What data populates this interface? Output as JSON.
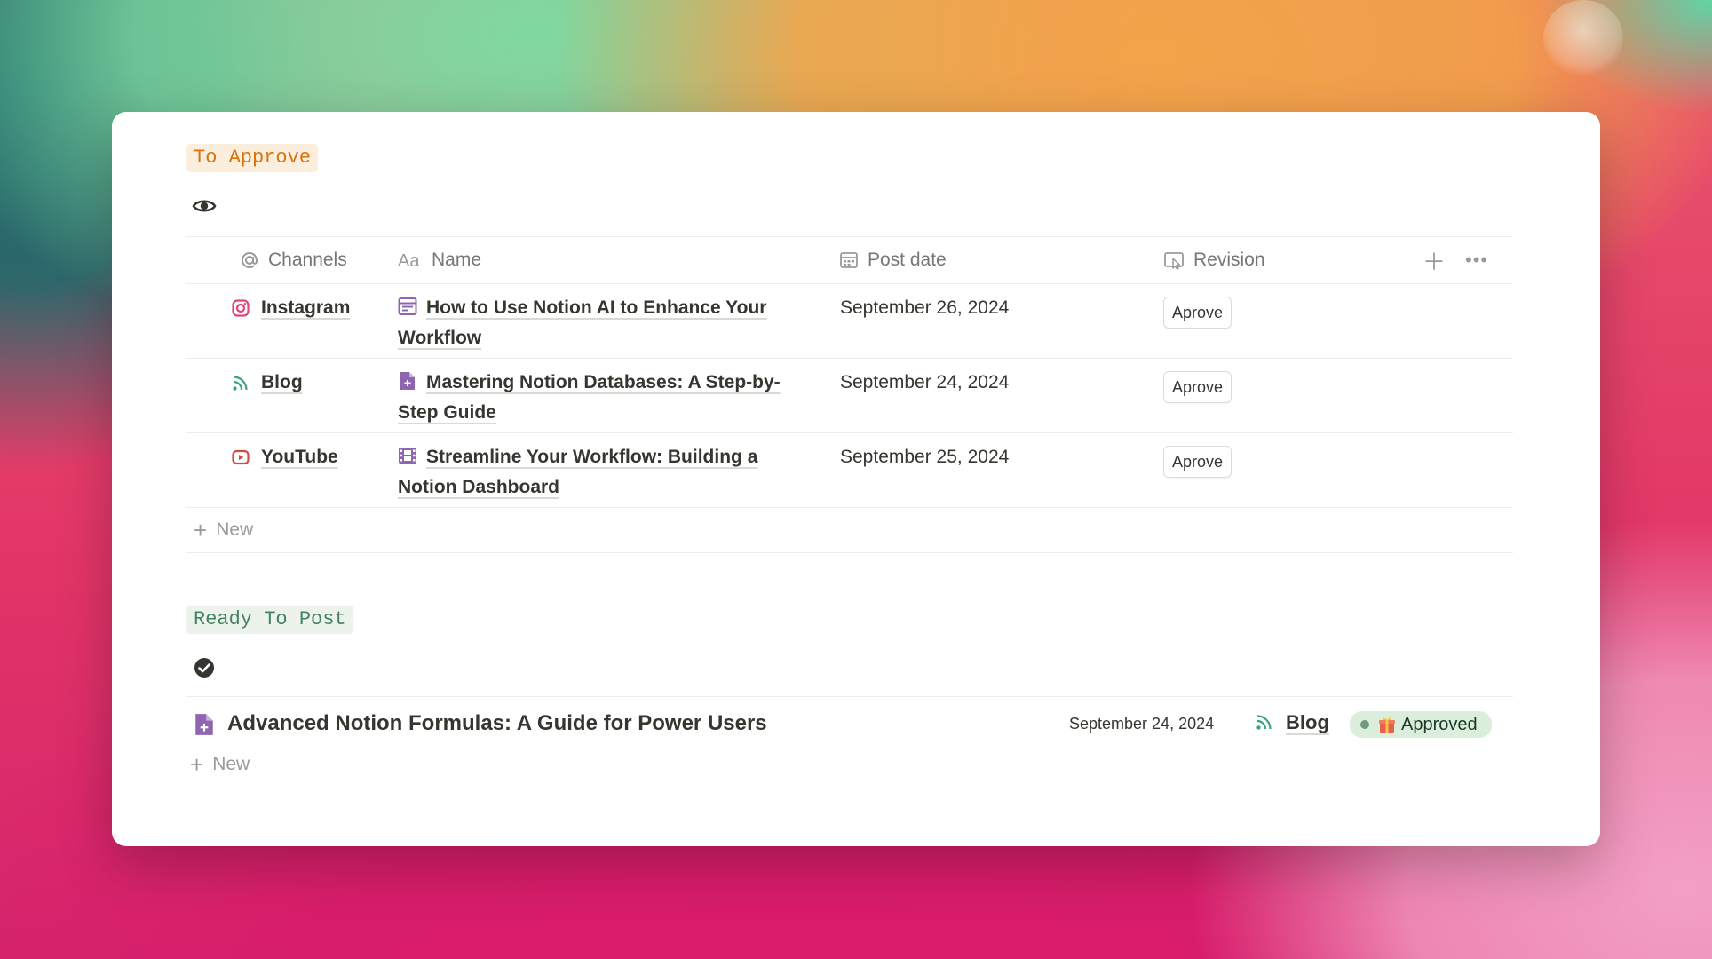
{
  "colors": {
    "to_approve_tag_bg": "#fbeedd",
    "to_approve_tag_text": "#d9730d",
    "ready_tag_bg": "#edf3ec",
    "ready_tag_text": "#448361",
    "approved_badge_bg": "#dbeddb",
    "instagram": "#e0457b",
    "blog": "#3aa57a",
    "youtube": "#d44c47",
    "page_icon": "#9065b0"
  },
  "to_approve": {
    "tag": "To Approve",
    "icon": "eye-icon",
    "columns": {
      "channels": "Channels",
      "name": "Name",
      "post_date": "Post date",
      "revision": "Revision"
    },
    "rows": [
      {
        "channel": "Instagram",
        "channel_icon": "instagram-icon",
        "name_icon": "calendar-layout-icon",
        "name": "How to Use Notion AI to Enhance Your Workflow",
        "post_date": "September 26, 2024",
        "revision_label": "Aprove"
      },
      {
        "channel": "Blog",
        "channel_icon": "rss-icon",
        "name_icon": "document-plus-icon",
        "name": "Mastering Notion Databases: A Step-by-Step Guide",
        "post_date": "September 24, 2024",
        "revision_label": "Aprove"
      },
      {
        "channel": "YouTube",
        "channel_icon": "youtube-icon",
        "name_icon": "film-icon",
        "name": "Streamline Your Workflow: Building a Notion Dashboard",
        "post_date": "September 25, 2024",
        "revision_label": "Aprove"
      }
    ],
    "new_label": "New"
  },
  "ready_to_post": {
    "tag": "Ready To Post",
    "icon": "check-circle-icon",
    "items": [
      {
        "icon": "document-plus-icon",
        "title": "Advanced Notion Formulas: A Guide for Power Users",
        "post_date": "September 24, 2024",
        "channel": "Blog",
        "channel_icon": "rss-icon",
        "status": "Approved",
        "status_icon": "gift-icon"
      }
    ],
    "new_label": "New"
  }
}
